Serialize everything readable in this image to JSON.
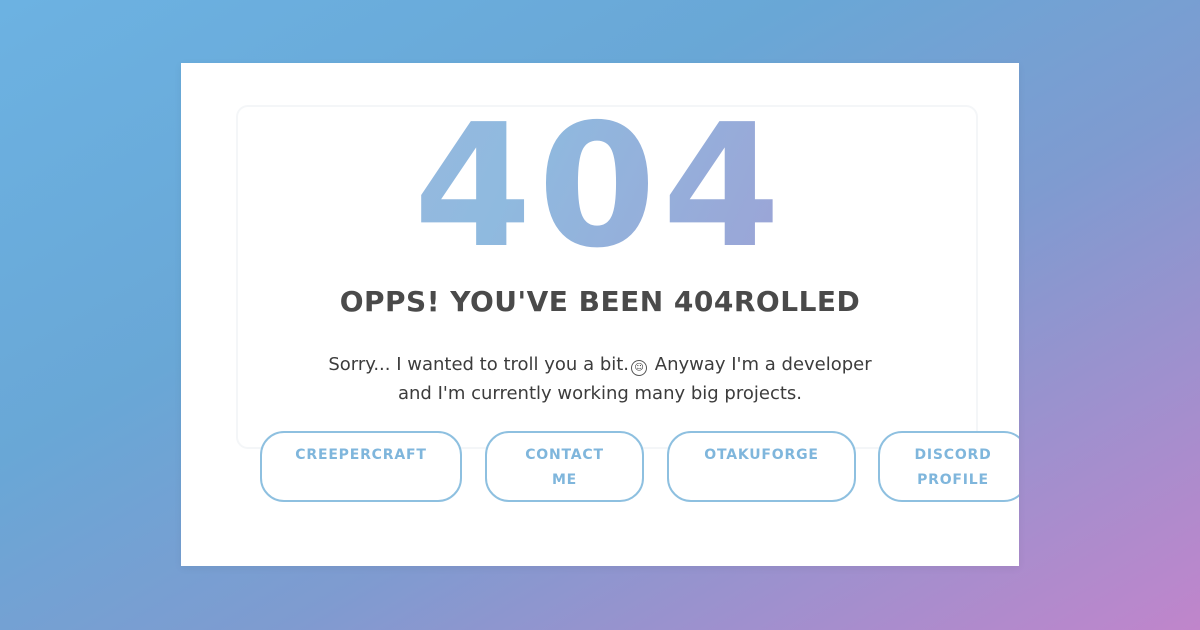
{
  "error": {
    "code": "404",
    "title": "OPPS! YOU'VE BEEN 404ROLLED",
    "message_line1_part1": "Sorry... I wanted to troll you a bit.",
    "message_line1_part2": " Anyway I'm a developer",
    "message_line2": "and I'm currently working many big projects.",
    "emoji_icon": "troll-face-icon"
  },
  "links": [
    {
      "label_line1": "CREEPERCRAFT",
      "label_line2": ""
    },
    {
      "label_line1": "CONTACT",
      "label_line2": "ME"
    },
    {
      "label_line1": "OTAKUFORGE",
      "label_line2": ""
    },
    {
      "label_line1": "DISCORD",
      "label_line2": "PROFILE"
    }
  ],
  "colors": {
    "background_start": "#6cb2e2",
    "background_end": "#c085cb",
    "button_border": "#8ec0e0",
    "button_text": "#7fb6dc",
    "title_text": "#4a4a4a"
  }
}
